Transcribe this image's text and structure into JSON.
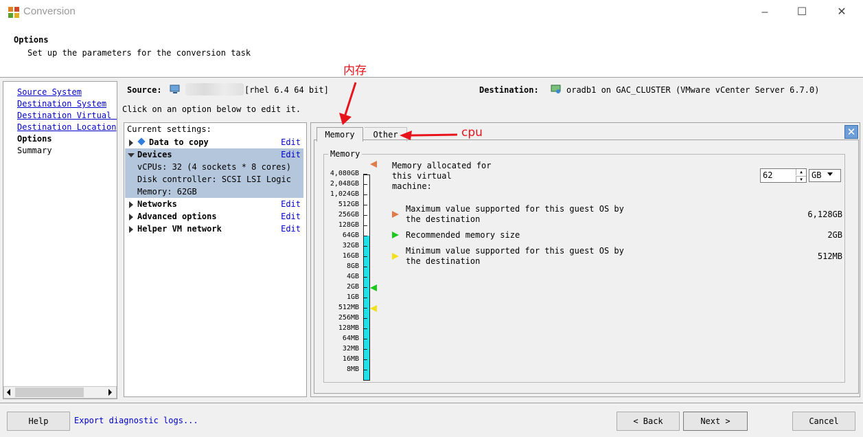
{
  "window": {
    "title": "Conversion",
    "minimize_icon": "–",
    "maximize_icon": "☐",
    "close_icon": "✕"
  },
  "header": {
    "title": "Options",
    "subtitle": "Set up the parameters for the conversion task"
  },
  "nav": {
    "items": [
      {
        "label": "Source System",
        "state": "link"
      },
      {
        "label": "Destination System",
        "state": "link"
      },
      {
        "label": "Destination Virtual Machine",
        "state": "link"
      },
      {
        "label": "Destination Location",
        "state": "link"
      },
      {
        "label": "Options",
        "state": "current"
      },
      {
        "label": "Summary",
        "state": "plain"
      }
    ]
  },
  "source": {
    "label": "Source:",
    "os": "[rhel 6.4 64 bit]"
  },
  "destination": {
    "label": "Destination:",
    "value": "oradb1 on GAC_CLUSTER (VMware vCenter Server 6.7.0)"
  },
  "hint": "Click on an option below to edit it.",
  "settings": {
    "title": "Current settings:",
    "edit_label": "Edit",
    "rows": [
      {
        "label": "Data to copy",
        "expanded": false
      },
      {
        "label": "Devices",
        "expanded": true
      },
      {
        "label": "Networks",
        "expanded": false
      },
      {
        "label": "Advanced options",
        "expanded": false
      },
      {
        "label": "Helper VM network",
        "expanded": false
      }
    ],
    "device_details": [
      "vCPUs: 32 (4 sockets * 8 cores)",
      "Disk controller: SCSI LSI Logic",
      "Memory: 62GB"
    ]
  },
  "tabs": [
    {
      "label": "Memory"
    },
    {
      "label": "Other"
    }
  ],
  "close_panel_icon": "✕",
  "memory": {
    "group_title": "Memory",
    "scale_labels": [
      "4,080GB",
      "2,048GB",
      "1,024GB",
      "512GB",
      "256GB",
      "128GB",
      "64GB",
      "32GB",
      "16GB",
      "8GB",
      "4GB",
      "2GB",
      "1GB",
      "512MB",
      "256MB",
      "128MB",
      "64MB",
      "32MB",
      "16MB",
      "8MB"
    ],
    "allocated_label": "Memory allocated for this virtual machine:",
    "allocated_value": "62",
    "unit": "GB",
    "legend": [
      {
        "label": "Maximum value supported for this guest OS by the destination",
        "value": "6,128GB",
        "color": "#e07c4a"
      },
      {
        "label": "Recommended memory size",
        "value": "2GB",
        "color": "#1cc81c"
      },
      {
        "label": "Minimum value supported for this guest OS by the destination",
        "value": "512MB",
        "color": "#f2e01a"
      }
    ]
  },
  "annotations": {
    "memory_note": "内存",
    "cpu_note": "cpu"
  },
  "footer": {
    "help": "Help",
    "export": "Export diagnostic logs...",
    "back": "< Back",
    "next": "Next >",
    "cancel": "Cancel"
  },
  "colors": {
    "link": "#0000cc",
    "scale_fill": "#22e0e8",
    "selection": "#b4c6dc",
    "annotation": "#e8141c"
  }
}
